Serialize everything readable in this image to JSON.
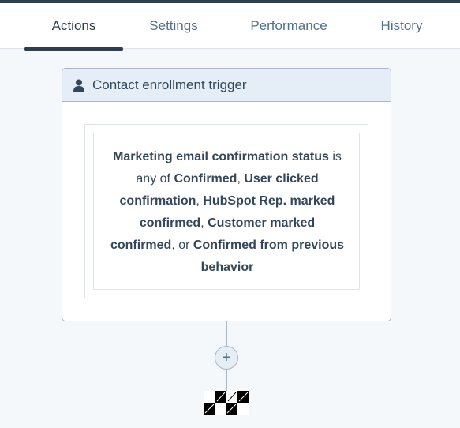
{
  "tabs": [
    {
      "label": "Actions",
      "active": true
    },
    {
      "label": "Settings",
      "active": false
    },
    {
      "label": "Performance",
      "active": false
    },
    {
      "label": "History",
      "active": false
    }
  ],
  "trigger": {
    "icon": "person-icon",
    "title": "Contact enrollment trigger",
    "filter": {
      "property": "Marketing email confirmation status",
      "operator_text": "is any of",
      "values": [
        "Confirmed",
        "User clicked confirmation",
        "HubSpot Rep. marked confirmed",
        "Customer marked confirmed",
        "Confirmed from previous behavior"
      ],
      "joiners": [
        ", ",
        ", ",
        ", ",
        ", or "
      ]
    }
  },
  "add_action": {
    "icon": "plus-icon",
    "label": "+"
  },
  "end": {
    "icon": "checkered-flag-icon"
  },
  "colors": {
    "top_bar": "#2d3e50",
    "text": "#33475b",
    "header_bg": "#e5edf6",
    "border": "#a9b7c6"
  }
}
